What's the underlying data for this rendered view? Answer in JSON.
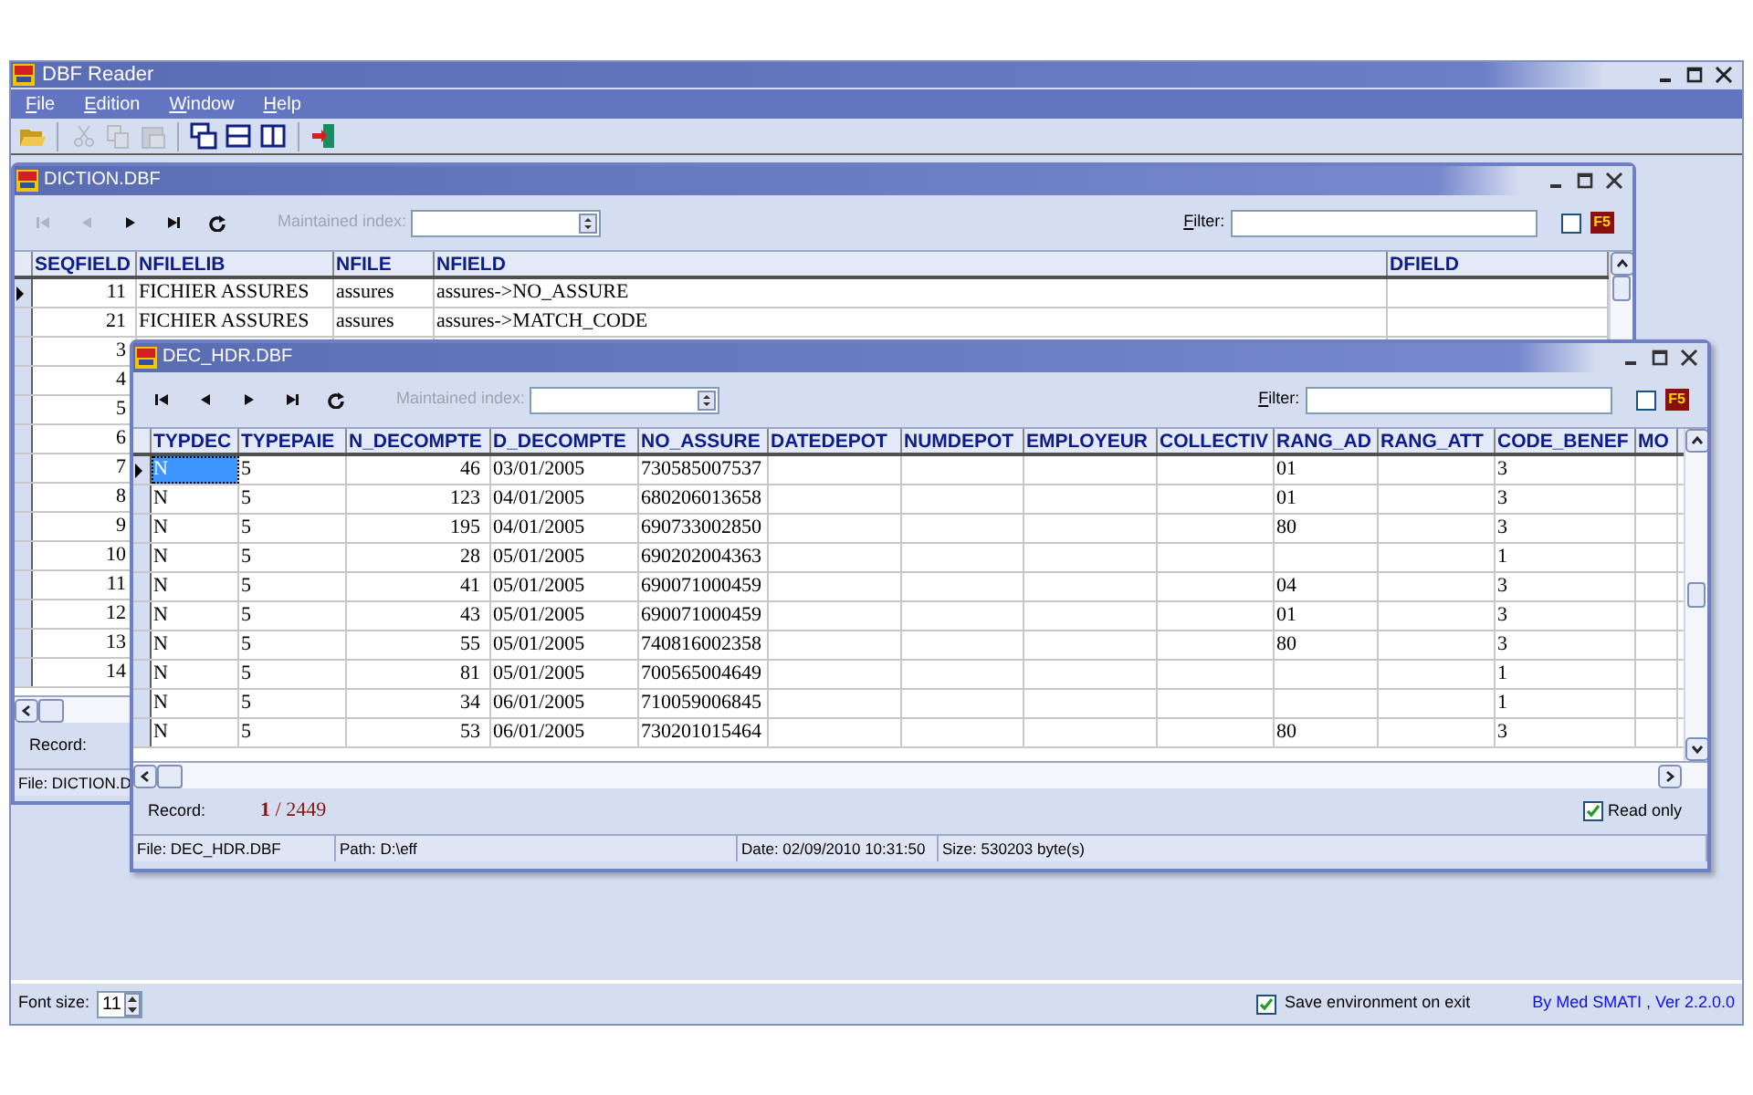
{
  "app": {
    "title": "DBF Reader"
  },
  "menu": [
    "File",
    "Edition",
    "Window",
    "Help"
  ],
  "toolbar": [
    [
      {
        "kind": "open",
        "disabled": false
      }
    ],
    [
      {
        "kind": "cut",
        "disabled": true
      },
      {
        "kind": "copy",
        "disabled": true
      },
      {
        "kind": "paste",
        "disabled": true
      }
    ],
    [
      {
        "kind": "cascade",
        "disabled": false
      },
      {
        "kind": "tile_horizontal",
        "disabled": false
      },
      {
        "kind": "tile_vertical",
        "disabled": false
      }
    ],
    [
      {
        "kind": "exit",
        "disabled": false
      }
    ]
  ],
  "windows": [
    {
      "title": "DICTION.DBF",
      "nav": [
        {
          "kind": "first",
          "disabled": true
        },
        {
          "kind": "prev",
          "disabled": true
        },
        {
          "kind": "next",
          "disabled": false
        },
        {
          "kind": "last",
          "disabled": false
        },
        {
          "kind": "refresh",
          "disabled": false
        }
      ],
      "index_label": "Maintained index:",
      "filter_label": "Filter:",
      "filter_checked": false,
      "refresh_key": "F5",
      "columns": [
        "SEQFIELD",
        "NFILELIB",
        "NFILE",
        "NFIELD",
        "DFIELD"
      ],
      "rows": [
        {
          "selected": true,
          "cells": [
            "11",
            "FICHIER ASSURES",
            "assures",
            "assures->NO_ASSURE",
            null
          ]
        },
        {
          "selected": false,
          "cells": [
            "21",
            "FICHIER ASSURES",
            "assures",
            "assures->MATCH_CODE",
            null
          ]
        },
        {
          "selected": false,
          "cells": [
            "3",
            null,
            null,
            null,
            null
          ]
        },
        {
          "selected": false,
          "cells": [
            "4",
            null,
            null,
            null,
            null
          ]
        },
        {
          "selected": false,
          "cells": [
            "5",
            null,
            null,
            null,
            null
          ]
        },
        {
          "selected": false,
          "cells": [
            "6",
            null,
            null,
            null,
            null
          ]
        },
        {
          "selected": false,
          "cells": [
            "7",
            null,
            null,
            null,
            null
          ]
        },
        {
          "selected": false,
          "cells": [
            "8",
            null,
            null,
            null,
            null
          ]
        },
        {
          "selected": false,
          "cells": [
            "9",
            null,
            null,
            null,
            null
          ]
        },
        {
          "selected": false,
          "cells": [
            "10",
            null,
            null,
            null,
            null
          ]
        },
        {
          "selected": false,
          "cells": [
            "11",
            null,
            null,
            null,
            null
          ]
        },
        {
          "selected": false,
          "cells": [
            "12",
            null,
            null,
            null,
            null
          ]
        },
        {
          "selected": false,
          "cells": [
            "13",
            null,
            null,
            null,
            null
          ]
        },
        {
          "selected": false,
          "cells": [
            "14",
            null,
            null,
            null,
            null
          ]
        }
      ],
      "record_label": "Record:",
      "status": [
        "File: DICTION.D"
      ]
    },
    {
      "title": "DEC_HDR.DBF",
      "nav": [
        {
          "kind": "first",
          "disabled": false
        },
        {
          "kind": "prev",
          "disabled": false
        },
        {
          "kind": "next",
          "disabled": false
        },
        {
          "kind": "last",
          "disabled": false
        },
        {
          "kind": "refresh",
          "disabled": false
        }
      ],
      "index_label": "Maintained index:",
      "filter_label": "Filter:",
      "filter_checked": false,
      "refresh_key": "F5",
      "columns": [
        "TYPDEC",
        "TYPEPAIE",
        "N_DECOMPTE",
        "D_DECOMPTE",
        "NO_ASSURE",
        "DATEDEPOT",
        "NUMDEPOT",
        "EMPLOYEUR",
        "COLLECTIV",
        "RANG_AD",
        "RANG_ATT",
        "CODE_BENEF",
        "MO"
      ],
      "rows": [
        {
          "selected": true,
          "cells": [
            "N",
            "5",
            "46",
            "03/01/2005",
            "730585007537",
            null,
            null,
            null,
            null,
            "01",
            null,
            "3",
            null
          ]
        },
        {
          "selected": false,
          "cells": [
            "N",
            "5",
            "123",
            "04/01/2005",
            "680206013658",
            null,
            null,
            null,
            null,
            "01",
            null,
            "3",
            null
          ]
        },
        {
          "selected": false,
          "cells": [
            "N",
            "5",
            "195",
            "04/01/2005",
            "690733002850",
            null,
            null,
            null,
            null,
            "80",
            null,
            "3",
            null
          ]
        },
        {
          "selected": false,
          "cells": [
            "N",
            "5",
            "28",
            "05/01/2005",
            "690202004363",
            null,
            null,
            null,
            null,
            null,
            null,
            "1",
            null
          ]
        },
        {
          "selected": false,
          "cells": [
            "N",
            "5",
            "41",
            "05/01/2005",
            "690071000459",
            null,
            null,
            null,
            null,
            "04",
            null,
            "3",
            null
          ]
        },
        {
          "selected": false,
          "cells": [
            "N",
            "5",
            "43",
            "05/01/2005",
            "690071000459",
            null,
            null,
            null,
            null,
            "01",
            null,
            "3",
            null
          ]
        },
        {
          "selected": false,
          "cells": [
            "N",
            "5",
            "55",
            "05/01/2005",
            "740816002358",
            null,
            null,
            null,
            null,
            "80",
            null,
            "3",
            null
          ]
        },
        {
          "selected": false,
          "cells": [
            "N",
            "5",
            "81",
            "05/01/2005",
            "700565004649",
            null,
            null,
            null,
            null,
            null,
            null,
            "1",
            null
          ]
        },
        {
          "selected": false,
          "cells": [
            "N",
            "5",
            "34",
            "06/01/2005",
            "710059006845",
            null,
            null,
            null,
            null,
            null,
            null,
            "1",
            null
          ]
        },
        {
          "selected": false,
          "cells": [
            "N",
            "5",
            "53",
            "06/01/2005",
            "730201015464",
            null,
            null,
            null,
            null,
            "80",
            null,
            "3",
            null
          ]
        }
      ],
      "record_label": "Record:",
      "record_position": "**1** / 2449",
      "read_only": {
        "label": "Read only",
        "checked": true
      },
      "status": [
        "File: DEC_HDR.DBF",
        "Path: D:\\eff",
        "Date: 02/09/2010 10:31:50",
        "Size: 530203 byte(s)"
      ]
    }
  ],
  "footer": {
    "font_size_label": "Font size:",
    "font_size": "11",
    "save_env": {
      "label": "Save environment on exit",
      "checked": true
    },
    "credit": "By Med SMATI , Ver 2.2.0.0"
  }
}
